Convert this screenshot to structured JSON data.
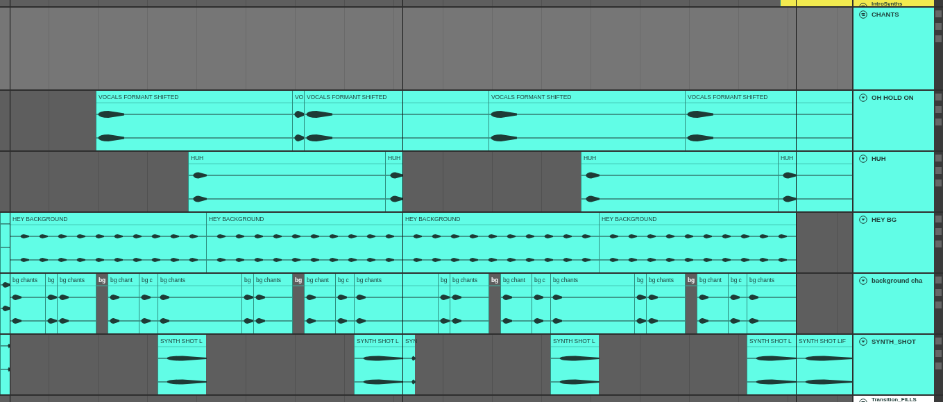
{
  "tracks": [
    {
      "name": "IntroSynths",
      "kind": "group",
      "color": "#f2ea4f",
      "clips": [
        {
          "disabled": false
        }
      ]
    },
    {
      "name": "CHANTS",
      "kind": "group",
      "color": "#61fde6"
    },
    {
      "name": "OH HOLD ON",
      "kind": "audio",
      "color": "#61fde6",
      "clips": [
        {
          "name": "VOCALS FORMANT SHIFTED",
          "disabled": false
        },
        {
          "name": "VO",
          "disabled": false
        },
        {
          "name": "VOCALS FORMANT SHIFTED",
          "disabled": false
        },
        {
          "name": "VOCALS FORMANT SHIFTED",
          "disabled": false
        },
        {
          "name": "VOCALS FORMANT SHIFTED",
          "disabled": false
        }
      ]
    },
    {
      "name": "HUH",
      "kind": "audio",
      "color": "#61fde6",
      "clips": [
        {
          "name": "HUH",
          "disabled": false
        },
        {
          "name": "HUH",
          "disabled": false
        },
        {
          "name": "HUH",
          "disabled": false
        },
        {
          "name": "HUH",
          "disabled": false
        }
      ]
    },
    {
      "name": "HEY BG",
      "kind": "audio",
      "color": "#61fde6",
      "clips": [
        {
          "disabled": false
        },
        {
          "name": "HEY BACKGROUND",
          "disabled": false
        },
        {
          "name": "HEY BACKGROUND",
          "disabled": false
        },
        {
          "name": "HEY BACKGROUND",
          "disabled": false
        },
        {
          "name": "HEY BACKGROUND",
          "disabled": false
        }
      ]
    },
    {
      "name": "background cha",
      "kind": "audio",
      "color": "#61fde6",
      "clips": [
        {
          "disabled": false
        },
        {
          "name": "bg chants",
          "disabled": false
        },
        {
          "name": "bg",
          "disabled": false
        },
        {
          "name": "bg chants",
          "disabled": false
        },
        {
          "name": "bg",
          "disabled": true
        },
        {
          "name": "bg chant",
          "disabled": false
        },
        {
          "name": "bg c",
          "disabled": false
        },
        {
          "name": "bg chants",
          "disabled": false
        },
        {
          "name": "bg",
          "disabled": false
        },
        {
          "name": "bg chants",
          "disabled": false
        },
        {
          "name": "bg",
          "disabled": true
        },
        {
          "name": "bg chant",
          "disabled": false
        },
        {
          "name": "bg c",
          "disabled": false
        },
        {
          "name": "bg chants",
          "disabled": false
        },
        {
          "name": "bg",
          "disabled": false
        },
        {
          "name": "bg chants",
          "disabled": false
        },
        {
          "name": "bg",
          "disabled": true
        },
        {
          "name": "bg chant",
          "disabled": false
        },
        {
          "name": "bg c",
          "disabled": false
        },
        {
          "name": "bg chants",
          "disabled": false
        },
        {
          "name": "bg",
          "disabled": false
        },
        {
          "name": "bg chants",
          "disabled": false
        },
        {
          "name": "bg",
          "disabled": true
        },
        {
          "name": "bg chant",
          "disabled": false
        },
        {
          "name": "bg c",
          "disabled": false
        },
        {
          "name": "bg chants",
          "disabled": false
        }
      ]
    },
    {
      "name": "SYNTH_SHOT",
      "kind": "audio",
      "color": "#61fde6",
      "clips": [
        {
          "disabled": false
        },
        {
          "name": "SYNTH SHOT L",
          "disabled": false
        },
        {
          "name": "SYNTH SHOT L",
          "disabled": false
        },
        {
          "name": "SYN",
          "disabled": false
        },
        {
          "name": "SYNTH SHOT L",
          "disabled": false
        },
        {
          "name": "SYNTH SHOT L",
          "disabled": false
        },
        {
          "name": "SYNTH SHOT LIF",
          "disabled": false
        }
      ]
    },
    {
      "name": "Transition_FILLS",
      "kind": "group",
      "color": "#ffffff"
    }
  ]
}
